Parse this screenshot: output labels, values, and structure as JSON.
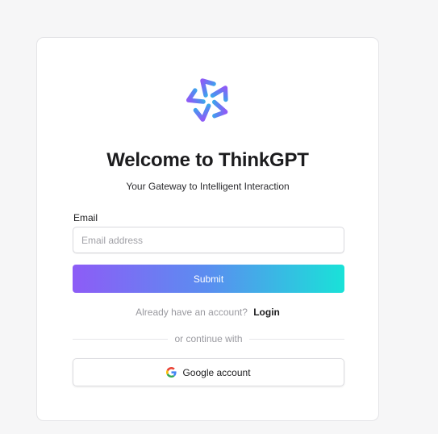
{
  "brand": {
    "title": "Welcome to ThinkGPT",
    "subtitle": "Your Gateway to Intelligent Interaction",
    "logo_icon": "sparkle-knot-logo-icon",
    "accent_start": "#8d5cf6",
    "accent_end": "#19e2d8"
  },
  "form": {
    "email_label": "Email",
    "email_placeholder": "Email address",
    "email_value": "",
    "submit_label": "Submit"
  },
  "account": {
    "prompt": "Already have an account?",
    "login_label": "Login"
  },
  "divider": {
    "text": "or continue with"
  },
  "oauth": {
    "google_label": "Google account",
    "google_icon": "google-icon"
  }
}
